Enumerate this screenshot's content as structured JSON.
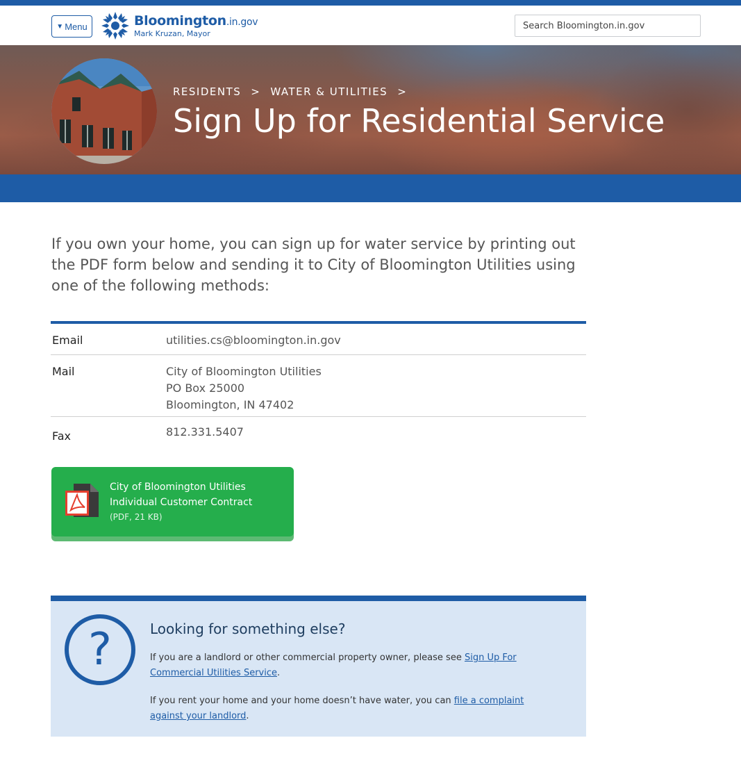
{
  "header": {
    "menu_label": "Menu",
    "logo_name": "Bloomington",
    "logo_domain": ".in.gov",
    "logo_subtitle": "Mark Kruzan, Mayor",
    "search_placeholder": "Search Bloomington.in.gov"
  },
  "hero": {
    "breadcrumb": [
      "RESIDENTS",
      "WATER & UTILITIES"
    ],
    "separator": ">",
    "title": "Sign Up for Residential Service"
  },
  "intro": "If you own your home, you can sign up for water service by printing out the PDF form below and sending it to City of Bloomington Utilities using one of the following methods:",
  "methods": {
    "email_label": "Email",
    "email_value": "utilities.cs@bloomington.in.gov",
    "mail_label": "Mail",
    "mail_lines": [
      "City of Bloomington Utilities",
      "PO Box 25000",
      "Bloomington, IN 47402"
    ],
    "fax_label": "Fax",
    "fax_value": "812.331.5407"
  },
  "pdf": {
    "title": "City of Bloomington Utilities Individual Customer Contract",
    "meta": "(PDF, 21 KB)",
    "icon": "pdf-file-icon"
  },
  "help": {
    "icon": "question-mark-icon",
    "title": "Looking for something else?",
    "p1_before": "If you are a landlord or other commercial property owner, please see ",
    "p1_link": "Sign Up For Commercial Utilities Service",
    "p1_after": ".",
    "p2_before": "If you rent your home and your home doesn’t have water, you can ",
    "p2_link": "file a complaint against your landlord",
    "p2_after": "."
  },
  "colors": {
    "brand_blue": "#1e5ca6",
    "pdf_green": "#25ae4c",
    "help_bg": "#d9e6f5"
  }
}
